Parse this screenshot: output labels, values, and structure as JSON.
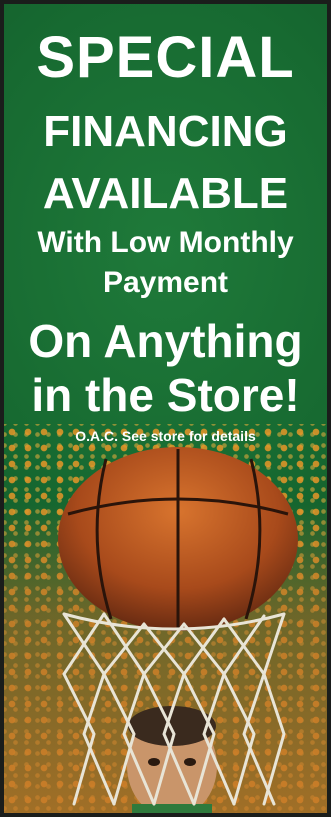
{
  "banner": {
    "line1": "SPECIAL",
    "line2": "FINANCING",
    "line3": "AVAILABLE",
    "line4": "With Low Monthly",
    "line5": "Payment",
    "line6": "On Anything",
    "line7": "in the Store!",
    "fine_print": "O.A.C. See store for details"
  },
  "colors": {
    "background_green": "#176a31",
    "text": "#ffffff",
    "accent_orange": "#e6962a",
    "ball": "#b5531c"
  },
  "icons": [
    "basketball-icon",
    "basketball-net-icon"
  ]
}
